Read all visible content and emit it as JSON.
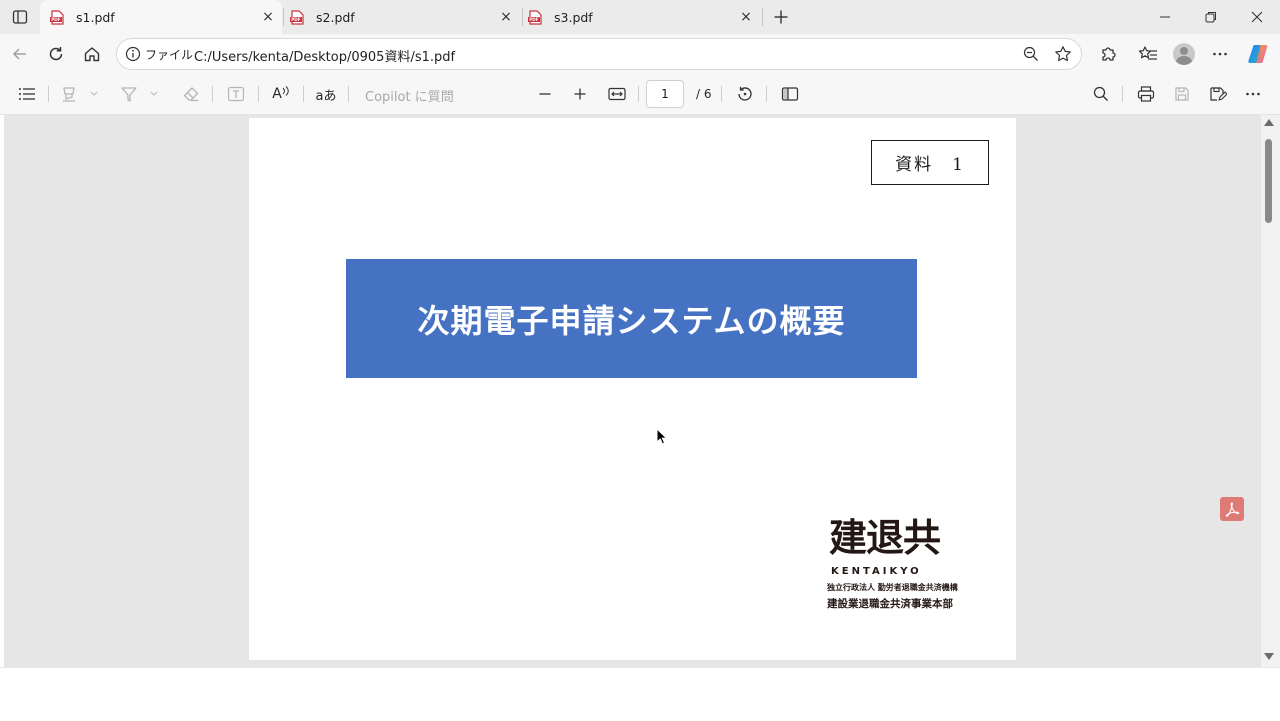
{
  "tabs": [
    {
      "title": "s1.pdf",
      "active": true
    },
    {
      "title": "s2.pdf",
      "active": false
    },
    {
      "title": "s3.pdf",
      "active": false
    }
  ],
  "tab_close_glyph": "×",
  "address": {
    "scheme_label": "ファイル",
    "url": "C:/Users/kenta/Desktop/0905資料/s1.pdf"
  },
  "pdf_toolbar": {
    "read_aloud_label": "A",
    "translate_label": "aあ",
    "copilot_placeholder": "Copilot に質問",
    "page_current": "1",
    "page_total": "/ 6"
  },
  "document": {
    "doc_number": "資料　1",
    "title": "次期電子申請システムの概要",
    "logo": {
      "main": "建退共",
      "romaji": "KENTAIKYO",
      "org_line1": "独立行政法人 勤労者退職金共済機構",
      "org_line2": "建設業退職金共済事業本部"
    }
  },
  "colors": {
    "title_banner": "#4672c4",
    "tab_pdf_icon": "#c8323c",
    "acrobat_badge": "#e07a76"
  },
  "icons": [
    "tab-actions-icon",
    "pdf-file-icon",
    "close-icon",
    "new-tab-icon",
    "minimize-icon",
    "restore-icon",
    "window-close-icon",
    "back-icon",
    "refresh-icon",
    "home-icon",
    "info-icon",
    "zoom-out-icon",
    "favorite-star-icon",
    "extensions-icon",
    "favorites-icon",
    "profile-avatar",
    "more-icon",
    "copilot-icon",
    "contents-icon",
    "highlight-icon",
    "draw-icon",
    "erase-icon",
    "text-icon",
    "read-aloud-icon",
    "translate-icon",
    "zoom-out-minus-icon",
    "zoom-in-plus-icon",
    "fit-page-icon",
    "rotate-icon",
    "page-view-icon",
    "search-icon",
    "print-icon",
    "save-icon",
    "save-as-icon",
    "acrobat-icon"
  ]
}
